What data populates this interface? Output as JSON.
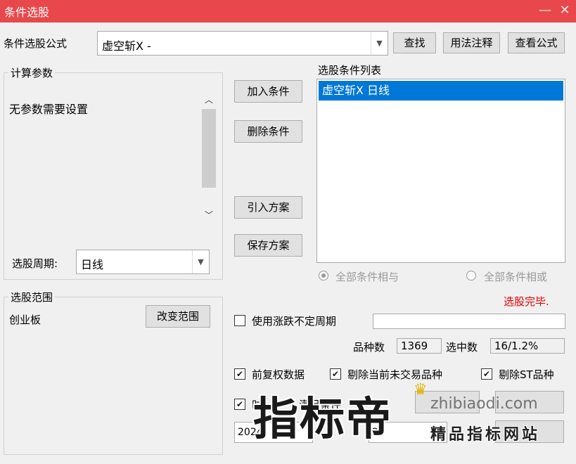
{
  "window": {
    "title": "条件选股",
    "minimize_glyph": "—",
    "close_glyph": "✕"
  },
  "formula": {
    "label": "条件选股公式",
    "value": "虚空斩X  -",
    "find_button": "查找",
    "usage_button": "用法注释",
    "view_button": "查看公式"
  },
  "params": {
    "group_label": "计算参数",
    "message": "无参数需要设置",
    "period_label": "选股周期:",
    "period_value": "日线"
  },
  "actions": {
    "add": "加入条件",
    "remove": "删除条件",
    "import": "引入方案",
    "save": "保存方案"
  },
  "conditions": {
    "label": "选股条件列表",
    "items": [
      "虚空斩X  日线"
    ],
    "radio_and": "全部条件相与",
    "radio_or": "全部条件相或",
    "status": "选股完毕."
  },
  "range": {
    "group_label": "选股范围",
    "value": "创业板",
    "change_button": "改变范围"
  },
  "options": {
    "variable_period": "使用涨跌不定周期",
    "count_label": "品种数",
    "count_value": "1369",
    "selected_label": "选中数",
    "selected_value": "16/1.2%",
    "forward_adjust": "前复权数据",
    "exclude_untraded": "剔除当前未交易品种",
    "exclude_st": "剔除ST品种",
    "partial_label": "时",
    "partial_label2": "满足条件",
    "date_start": "2024",
    "date_end": "20"
  },
  "watermark": {
    "text": "指标帝",
    "slogan": "精品指标网站",
    "domain": "zhibiaodi.com"
  },
  "colors": {
    "titlebar": "#e8484b",
    "status": "#e00000",
    "selection": "#0078d7"
  }
}
